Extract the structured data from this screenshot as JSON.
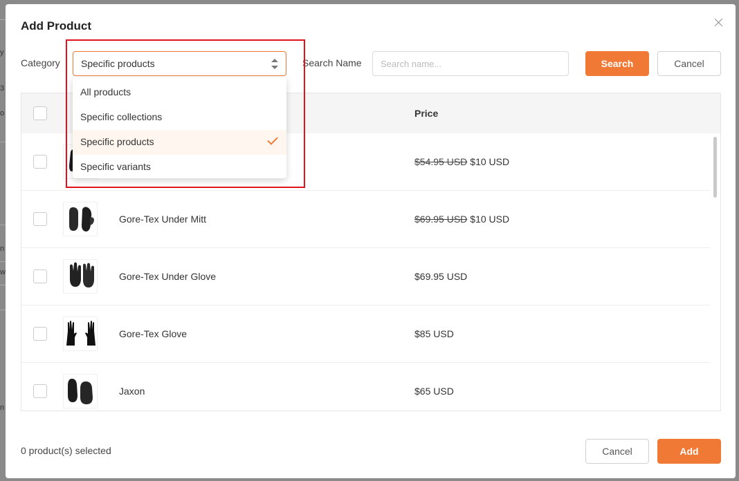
{
  "background": {
    "glyphs": [
      "y",
      "3",
      "o",
      "n",
      "w",
      "n"
    ]
  },
  "modal": {
    "title": "Add Product",
    "close_label": "×"
  },
  "filters": {
    "category_label": "Category",
    "category_value": "Specific products",
    "search_label": "Search Name",
    "search_placeholder": "Search name...",
    "search_button": "Search",
    "cancel_button": "Cancel"
  },
  "dropdown": {
    "options": [
      {
        "label": "All products",
        "selected": false
      },
      {
        "label": "Specific collections",
        "selected": false
      },
      {
        "label": "Specific products",
        "selected": true
      },
      {
        "label": "Specific variants",
        "selected": false
      }
    ]
  },
  "table": {
    "price_header": "Price",
    "rows": [
      {
        "name": "",
        "old_price": "$54.95 USD",
        "price": "$10 USD"
      },
      {
        "name": "Gore-Tex Under Mitt",
        "old_price": "$69.95 USD",
        "price": "$10 USD"
      },
      {
        "name": "Gore-Tex Under Glove",
        "old_price": "",
        "price": "$69.95 USD"
      },
      {
        "name": "Gore-Tex Glove",
        "old_price": "",
        "price": "$85 USD"
      },
      {
        "name": "Jaxon",
        "old_price": "",
        "price": "$65 USD"
      }
    ]
  },
  "footer": {
    "selected_count": "0 product(s) selected",
    "cancel_button": "Cancel",
    "add_button": "Add"
  },
  "colors": {
    "accent": "#f07a35",
    "annotation": "#e0121a"
  },
  "icons": {
    "close": "close-icon",
    "select_arrows": "sort-arrows-icon",
    "selected_option": "check-icon",
    "product_thumbnail": "glove-icon"
  }
}
